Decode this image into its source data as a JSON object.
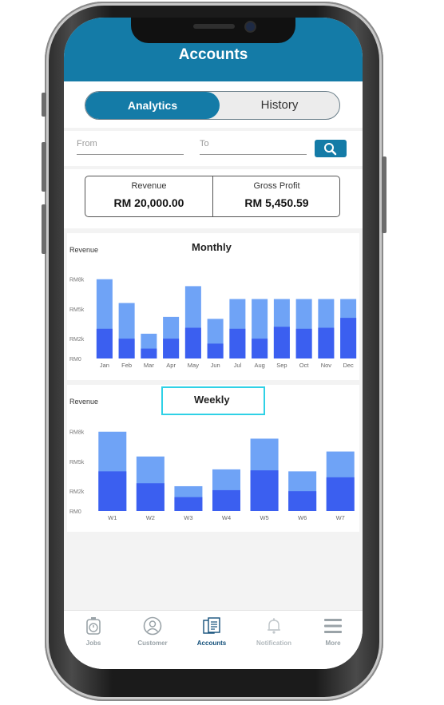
{
  "header": {
    "title": "Accounts"
  },
  "segment": {
    "active": "Analytics",
    "inactive": "History"
  },
  "filter": {
    "from_placeholder": "From",
    "to_placeholder": "To",
    "search_icon": "search-icon"
  },
  "summary": {
    "revenue_label": "Revenue",
    "revenue_value": "RM 20,000.00",
    "profit_label": "Gross Profit",
    "profit_value": "RM 5,450.59"
  },
  "colors": {
    "primary": "#147ba7",
    "bar_light": "#6fa3f6",
    "bar_dark": "#3b5ff0",
    "highlight_border": "#2fd1e6"
  },
  "chart_data": [
    {
      "type": "bar",
      "title": "Monthly",
      "ylabel": "Revenue",
      "yticks": [
        "RM0",
        "RM2k",
        "RM5k",
        "RM8k"
      ],
      "ytick_values": [
        0,
        2,
        5,
        8
      ],
      "ylim": [
        0,
        8.3
      ],
      "categories": [
        "Jan",
        "Feb",
        "Mar",
        "Apr",
        "May",
        "Jun",
        "Jul",
        "Aug",
        "Sep",
        "Oct",
        "Nov",
        "Dec"
      ],
      "series": [
        {
          "values": [
            3.0,
            2.0,
            1.0,
            2.0,
            3.1,
            1.5,
            3.0,
            2.0,
            3.2,
            3.0,
            3.1,
            4.1
          ]
        },
        {
          "values": [
            8.0,
            5.6,
            2.5,
            4.2,
            7.3,
            4.0,
            6.0,
            6.0,
            6.0,
            6.0,
            6.0,
            6.0
          ]
        }
      ]
    },
    {
      "type": "bar",
      "title": "Weekly",
      "ylabel": "Revenue",
      "yticks": [
        "RM0",
        "RM2k",
        "RM5k",
        "RM8k"
      ],
      "ytick_values": [
        0,
        2,
        5,
        8
      ],
      "ylim": [
        0,
        8.3
      ],
      "categories": [
        "W1",
        "W2",
        "W3",
        "W4",
        "W5",
        "W6",
        "W7"
      ],
      "series": [
        {
          "values": [
            4.0,
            2.8,
            1.4,
            2.1,
            4.1,
            2.0,
            3.4
          ]
        },
        {
          "values": [
            8.0,
            5.5,
            2.5,
            4.2,
            7.3,
            4.0,
            6.0
          ]
        }
      ]
    }
  ],
  "tabs": [
    {
      "label": "Jobs",
      "icon": "stopwatch-icon",
      "active": false
    },
    {
      "label": "Customer",
      "icon": "user-icon",
      "active": false
    },
    {
      "label": "Accounts",
      "icon": "document-icon",
      "active": true
    },
    {
      "label": "Notification",
      "icon": "bell-icon",
      "active": false
    },
    {
      "label": "More",
      "icon": "menu-icon",
      "active": false
    }
  ]
}
